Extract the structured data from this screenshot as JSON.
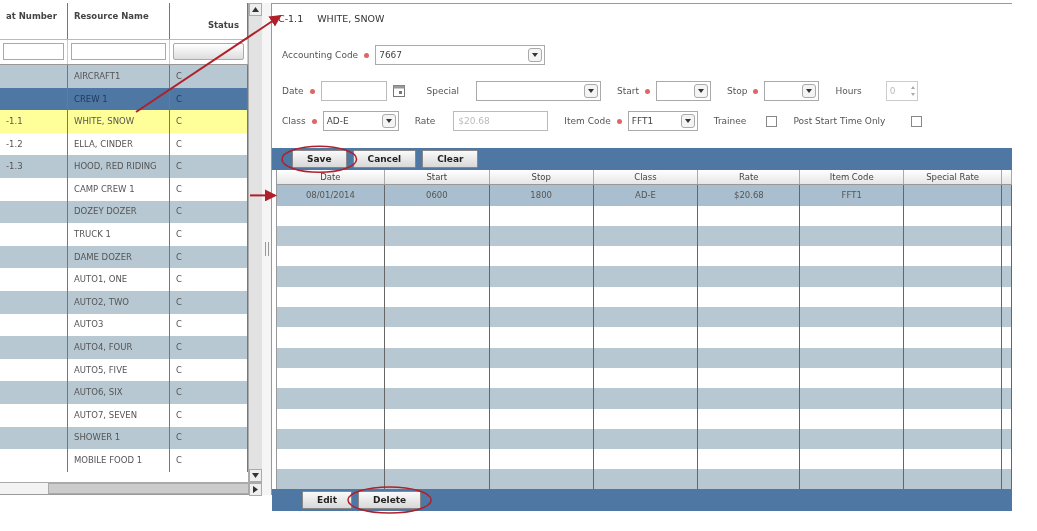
{
  "resource_table": {
    "columns": [
      "at Number",
      "Resource Name",
      "Status"
    ],
    "rows": [
      {
        "cells": [
          "",
          "AIRCRAFT1",
          "C"
        ],
        "selected": false,
        "highlighted": false
      },
      {
        "cells": [
          "",
          "CREW 1",
          "C"
        ],
        "selected": true,
        "highlighted": false
      },
      {
        "cells": [
          "-1.1",
          "WHITE, SNOW",
          "C"
        ],
        "selected": false,
        "highlighted": true
      },
      {
        "cells": [
          "-1.2",
          "ELLA, CINDER",
          "C"
        ],
        "selected": false,
        "highlighted": false
      },
      {
        "cells": [
          "-1.3",
          "HOOD, RED RIDING",
          "C"
        ],
        "selected": false,
        "highlighted": false
      },
      {
        "cells": [
          "",
          "CAMP CREW 1",
          "C"
        ],
        "selected": false,
        "highlighted": false
      },
      {
        "cells": [
          "",
          "DOZEY DOZER",
          "C"
        ],
        "selected": false,
        "highlighted": false
      },
      {
        "cells": [
          "",
          "TRUCK 1",
          "C"
        ],
        "selected": false,
        "highlighted": false
      },
      {
        "cells": [
          "",
          "DAME DOZER",
          "C"
        ],
        "selected": false,
        "highlighted": false
      },
      {
        "cells": [
          "",
          "AUTO1, ONE",
          "C"
        ],
        "selected": false,
        "highlighted": false
      },
      {
        "cells": [
          "",
          "AUTO2, TWO",
          "C"
        ],
        "selected": false,
        "highlighted": false
      },
      {
        "cells": [
          "",
          "AUTO3",
          "C"
        ],
        "selected": false,
        "highlighted": false
      },
      {
        "cells": [
          "",
          "AUTO4, FOUR",
          "C"
        ],
        "selected": false,
        "highlighted": false
      },
      {
        "cells": [
          "",
          "AUTO5, FIVE",
          "C"
        ],
        "selected": false,
        "highlighted": false
      },
      {
        "cells": [
          "",
          "AUTO6, SIX",
          "C"
        ],
        "selected": false,
        "highlighted": false
      },
      {
        "cells": [
          "",
          "AUTO7, SEVEN",
          "C"
        ],
        "selected": false,
        "highlighted": false
      },
      {
        "cells": [
          "",
          "SHOWER 1",
          "C"
        ],
        "selected": false,
        "highlighted": false
      },
      {
        "cells": [
          "",
          "MOBILE FOOD 1",
          "C"
        ],
        "selected": false,
        "highlighted": false
      }
    ]
  },
  "detail": {
    "title_code": "C-1.1",
    "title_name": "WHITE, SNOW",
    "form_rows": [
      [
        {
          "kind": "select",
          "label": "Accounting Code",
          "required": true,
          "value": "7667"
        }
      ],
      [
        {
          "kind": "date",
          "label": "Date",
          "required": true
        },
        {
          "kind": "select",
          "label": "Special"
        },
        {
          "kind": "select",
          "label": "Start",
          "required": true
        },
        {
          "kind": "select",
          "label": "Stop",
          "required": true
        },
        {
          "kind": "spin",
          "label": "Hours",
          "value": "0",
          "disabled": true
        }
      ],
      [
        {
          "kind": "select",
          "label": "Class",
          "required": true,
          "value": "AD-E"
        },
        {
          "kind": "text",
          "label": "Rate",
          "value": "$20.68",
          "disabled": true
        },
        {
          "kind": "select",
          "label": "Item Code",
          "required": true,
          "value": "FFT1"
        },
        {
          "kind": "checkbox",
          "label": "Trainee",
          "checked": false
        },
        {
          "kind": "checkbox",
          "label": "Post Start Time Only",
          "checked": false
        }
      ]
    ],
    "buttons": [
      "Save",
      "Cancel",
      "Clear"
    ],
    "grid": {
      "columns": [
        "Date",
        "Start",
        "Stop",
        "Class",
        "Rate",
        "Item Code",
        "Special Rate"
      ],
      "rows": [
        {
          "cells": [
            "08/01/2014",
            "0600",
            "1800",
            "AD-E",
            "$20.68",
            "FFT1",
            ""
          ],
          "selected": true
        }
      ]
    },
    "bottom_buttons": [
      "Edit",
      "Delete"
    ]
  }
}
